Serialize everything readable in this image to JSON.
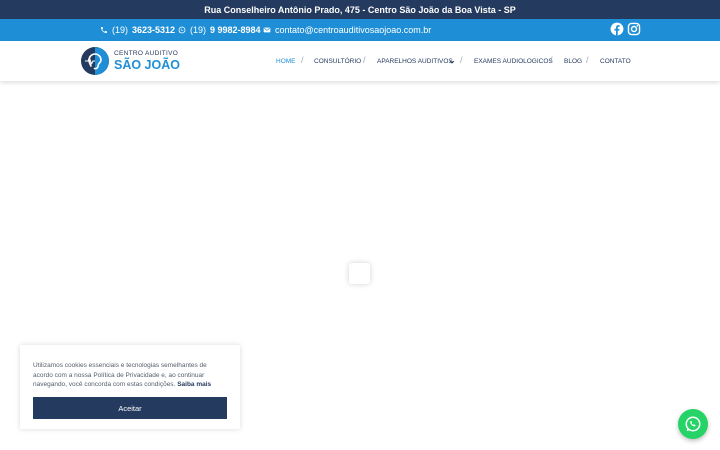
{
  "top_bar": {
    "address": "Rua Conselheiro Antônio Prado, 475 - Centro São João da Boa Vista - SP"
  },
  "contact_bar": {
    "phone_prefix": "(19)",
    "phone_number": "3623-5312",
    "whatsapp_prefix": "(19)",
    "whatsapp_number": "9 9982-8984",
    "email": "contato@centroauditivosaojoao.com.br",
    "icons": [
      "phone-icon",
      "whatsapp-icon",
      "envelope-icon",
      "facebook-icon",
      "instagram-icon"
    ]
  },
  "header": {
    "logo_top": "CENTRO AUDITIVO",
    "logo_main": "SÃO JOÃO",
    "nav": {
      "home": "HOME",
      "consultorio": "CONSULTÓRIO",
      "aparelhos": "APARELHOS AUDITIVOS",
      "exames": "EXAMES AUDIOLOGICOS",
      "blog": "BLOG",
      "contato": "CONTATO"
    },
    "separator": "/"
  },
  "cookie_banner": {
    "text": "Utilizamos cookies essenciais e tecnologias semelhantes de acordo com a nossa Política de Privacidade e, ao continuar navegando, você concorda com estas condições.",
    "link": "Saiba mais",
    "accept_label": "Aceitar"
  },
  "colors": {
    "navy": "#243a5e",
    "blue": "#1e8fd6",
    "whatsapp_green": "#25d366"
  }
}
